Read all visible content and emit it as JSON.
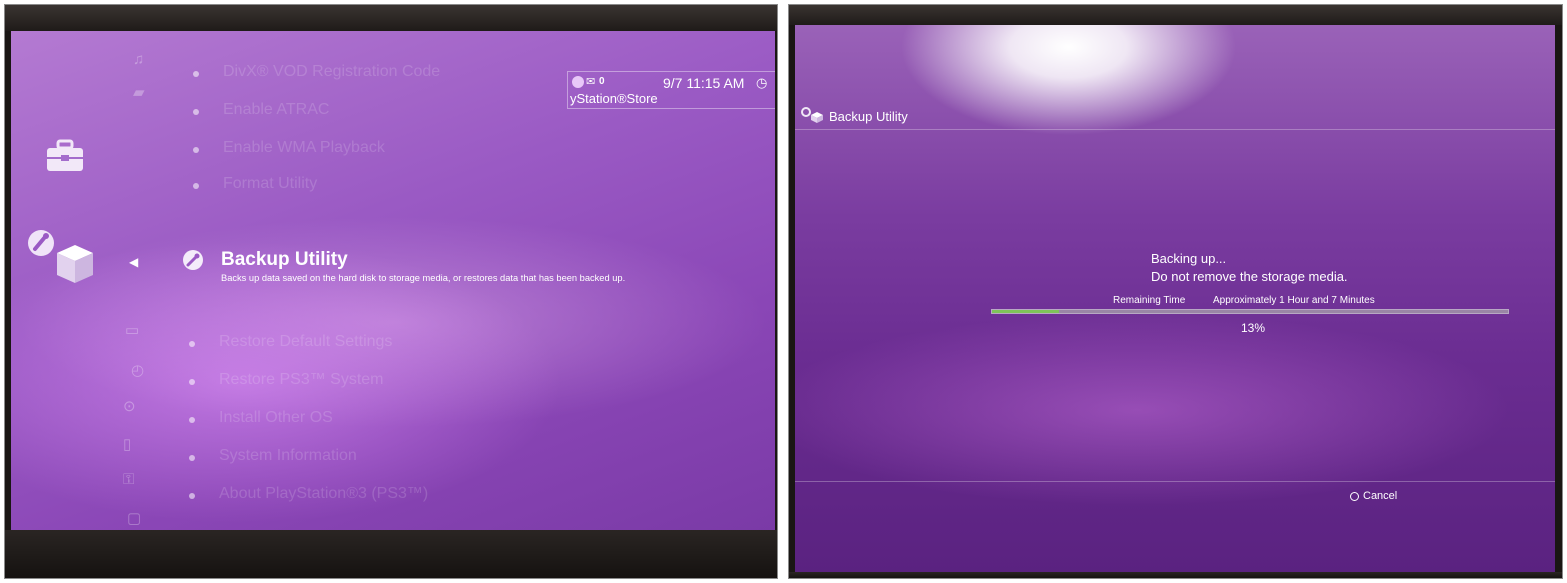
{
  "left_screen": {
    "menu_items_above": [
      {
        "label": "DivX® VOD Registration Code"
      },
      {
        "label": "Enable ATRAC"
      },
      {
        "label": "Enable WMA Playback"
      },
      {
        "label": "Format Utility"
      }
    ],
    "selected_item": {
      "label": "Backup Utility",
      "description": "Backs up data saved on the hard disk to storage media, or restores data that has been backed up."
    },
    "menu_items_below": [
      {
        "label": "Restore Default Settings"
      },
      {
        "label": "Restore PS3™ System"
      },
      {
        "label": "Install Other OS"
      },
      {
        "label": "System Information"
      },
      {
        "label": "About PlayStation®3 (PS3™)"
      }
    ],
    "status": {
      "mail_count": "0",
      "datetime": "9/7 11:15 AM",
      "store_text": "yStation®Store"
    },
    "category_icon": "toolbox-icon",
    "colors": {
      "accent": "#9a5ac4",
      "selected_text": "#ffffff"
    }
  },
  "right_screen": {
    "header_title": "Backup Utility",
    "message_line1": "Backing up...",
    "message_line2": "Do not remove the storage media.",
    "remaining_label": "Remaining Time",
    "remaining_value": "Approximately 1 Hour and 7 Minutes",
    "progress_text": "13%",
    "progress_value": 0.13,
    "cancel_label": "Cancel",
    "colors": {
      "progress_fill": "#7fc35a",
      "progress_track": "#9a86a6"
    }
  }
}
